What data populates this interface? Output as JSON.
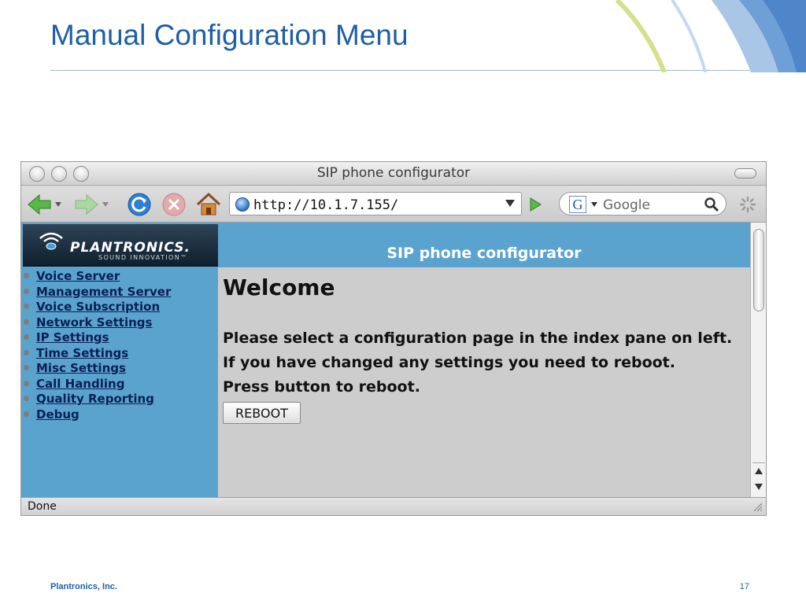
{
  "slide": {
    "title": "Manual Configuration Menu",
    "footer_company": "Plantronics, Inc.",
    "page_number": "17"
  },
  "colors": {
    "title_blue": "#1f5fa6",
    "panel_blue": "#5ba3cf",
    "content_grey": "#cdcdcd",
    "link_navy": "#0a1f55"
  },
  "browser": {
    "window_title": "SIP phone configurator",
    "url": "http://10.1.7.155/",
    "search_placeholder": "Google",
    "search_engine_letter": "G",
    "status": "Done",
    "icons": [
      "back-arrow-icon",
      "forward-arrow-icon",
      "reload-icon",
      "stop-icon",
      "home-icon",
      "globe-icon",
      "go-arrow-icon",
      "magnifier-icon",
      "spinner-icon"
    ]
  },
  "sidebar": {
    "brand_name": "PLANTRONICS.",
    "brand_tagline": "SOUND INNOVATION",
    "brand_trademark": "™",
    "items": [
      {
        "label": "Voice Server"
      },
      {
        "label": "Management Server"
      },
      {
        "label": "Voice Subscription"
      },
      {
        "label": "Network Settings"
      },
      {
        "label": "IP Settings"
      },
      {
        "label": "Time Settings"
      },
      {
        "label": "Misc Settings"
      },
      {
        "label": "Call Handling"
      },
      {
        "label": "Quality Reporting"
      },
      {
        "label": "Debug"
      }
    ]
  },
  "main": {
    "header": "SIP phone configurator",
    "welcome": "Welcome",
    "lines": [
      "Please select a configuration page in the index pane on left.",
      "If you have changed any settings you need to reboot.",
      "Press button to reboot."
    ],
    "reboot_label": "REBOOT"
  }
}
